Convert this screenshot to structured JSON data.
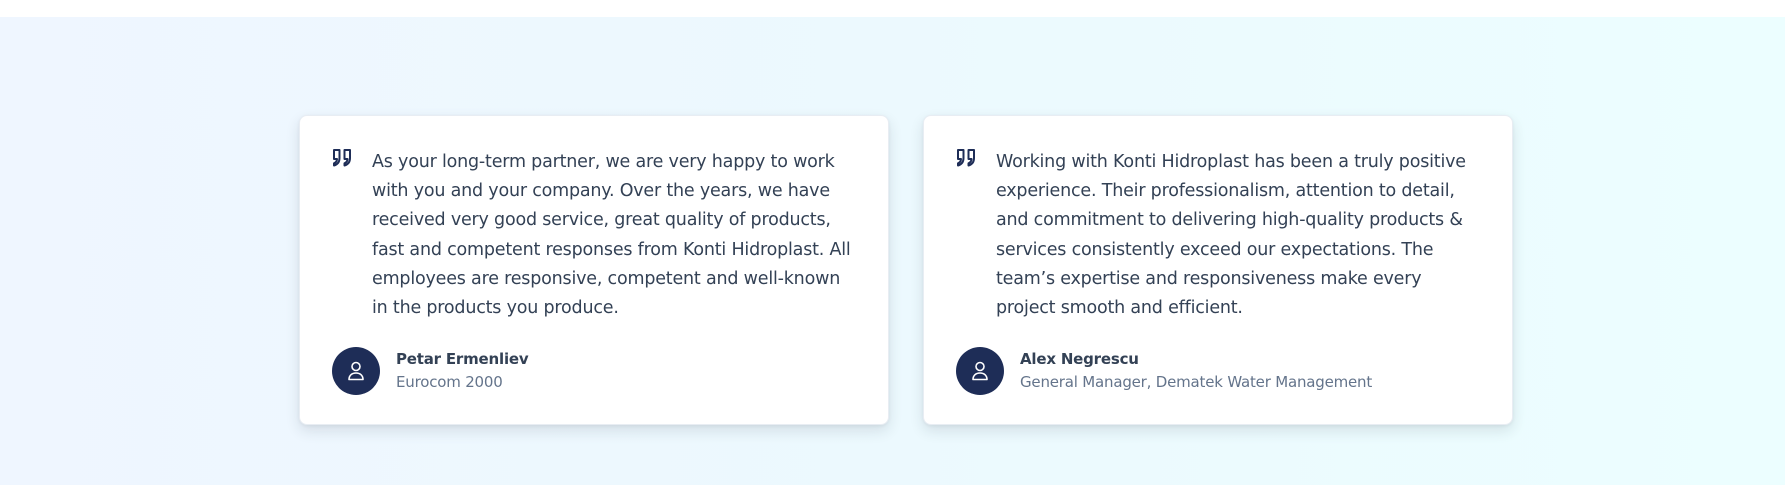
{
  "testimonials": [
    {
      "quote": "As your long-term partner, we are very happy to work with you and your company. Over the years, we have received very good service, great quality of products, fast and competent responses from Konti Hidroplast. All employees are responsive, competent and well-known in the products you produce.",
      "name": "Petar Ermenliev",
      "role": "Eurocom 2000"
    },
    {
      "quote": "Working with Konti Hidroplast has been a truly positive experience. Their professionalism, attention to detail, and commitment to delivering high-quality products & services consistently exceed our expectations. The team’s expertise and responsiveness make every project smooth and efficient.",
      "name": "Alex Negrescu",
      "role": "General Manager, Dematek Water Management"
    }
  ],
  "colors": {
    "accent": "#1e2d57",
    "text": "#334155",
    "muted": "#64748b"
  },
  "icons": {
    "quote": "quote-icon",
    "avatar": "user-icon"
  }
}
